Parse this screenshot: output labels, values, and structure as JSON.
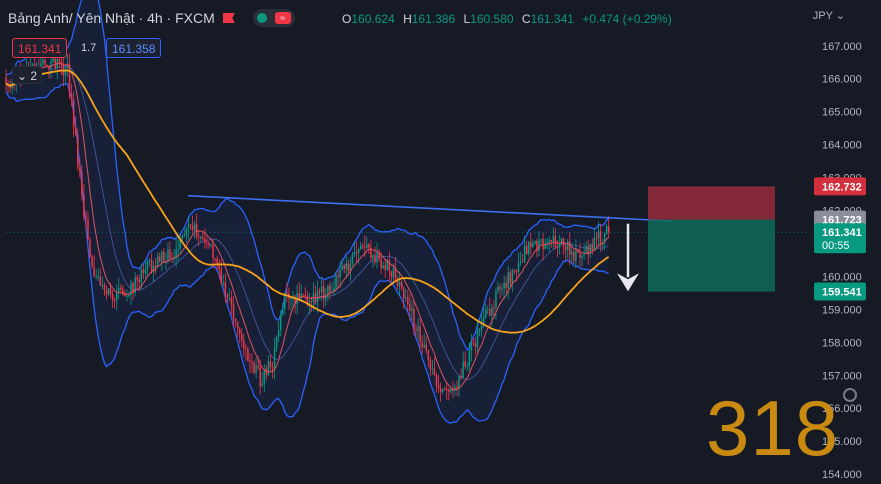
{
  "header": {
    "title": "Bảng Anh/ Yên Nhật · 4h · FXCM",
    "ohlc": {
      "o_label": "O",
      "o": "160.624",
      "h_label": "H",
      "h": "161.386",
      "l_label": "L",
      "l": "160.580",
      "c_label": "C",
      "c": "161.341",
      "change": "+0.474 (+0.29%)"
    }
  },
  "trade": {
    "sell": "161.341",
    "spread": "1.7",
    "buy": "161.358"
  },
  "indicator_collapse": "2",
  "currency": "JPY",
  "watermark": "318",
  "colors": {
    "up": "#089981",
    "down": "#f23645",
    "ma_slow": "#f7a21b",
    "ma_fast": "#e0525c",
    "band": "#2962ff",
    "trend": "#3d6ff0",
    "risk": "#8f2a38",
    "reward": "#0e6b5c"
  },
  "chart_data": {
    "type": "candlestick",
    "price_axis": {
      "ticks": [
        "167.000",
        "166.000",
        "165.000",
        "164.000",
        "163.000",
        "162.000",
        "161.000",
        "160.000",
        "159.000",
        "158.000",
        "157.000",
        "156.000",
        "155.000",
        "154.000"
      ],
      "range": [
        153.7,
        167.6
      ]
    },
    "price_labels": {
      "stop": "162.732",
      "entry": "161.723",
      "current": "161.341",
      "countdown": "00:55",
      "target": "159.541"
    },
    "anchors": [
      [
        0,
        165.9
      ],
      [
        20,
        166.4
      ],
      [
        30,
        166.3
      ],
      [
        38,
        161.8
      ],
      [
        44,
        159.8
      ],
      [
        52,
        159.4
      ],
      [
        60,
        159.6
      ],
      [
        70,
        160.3
      ],
      [
        82,
        160.8
      ],
      [
        90,
        161.6
      ],
      [
        96,
        161.3
      ],
      [
        104,
        160.2
      ],
      [
        110,
        159.1
      ],
      [
        118,
        157.6
      ],
      [
        124,
        156.9
      ],
      [
        130,
        157.4
      ],
      [
        136,
        159.5
      ],
      [
        146,
        159.3
      ],
      [
        156,
        159.5
      ],
      [
        166,
        160.3
      ],
      [
        174,
        160.8
      ],
      [
        182,
        160.5
      ],
      [
        190,
        160.0
      ],
      [
        198,
        158.8
      ],
      [
        206,
        157.4
      ],
      [
        212,
        156.6
      ],
      [
        220,
        156.8
      ],
      [
        226,
        157.6
      ],
      [
        232,
        158.6
      ],
      [
        240,
        159.5
      ],
      [
        248,
        160.2
      ],
      [
        256,
        161.0
      ],
      [
        264,
        161.0
      ],
      [
        272,
        161.1
      ],
      [
        280,
        160.4
      ],
      [
        286,
        161.0
      ],
      [
        290,
        161.2
      ],
      [
        294,
        161.33
      ]
    ],
    "seed": 318,
    "trendline": {
      "start": [
        0,
        162.45
      ],
      "end": [
        300,
        161.68
      ]
    },
    "position": {
      "type": "short",
      "entry": 161.723,
      "stop": 162.732,
      "target": 159.541
    }
  }
}
